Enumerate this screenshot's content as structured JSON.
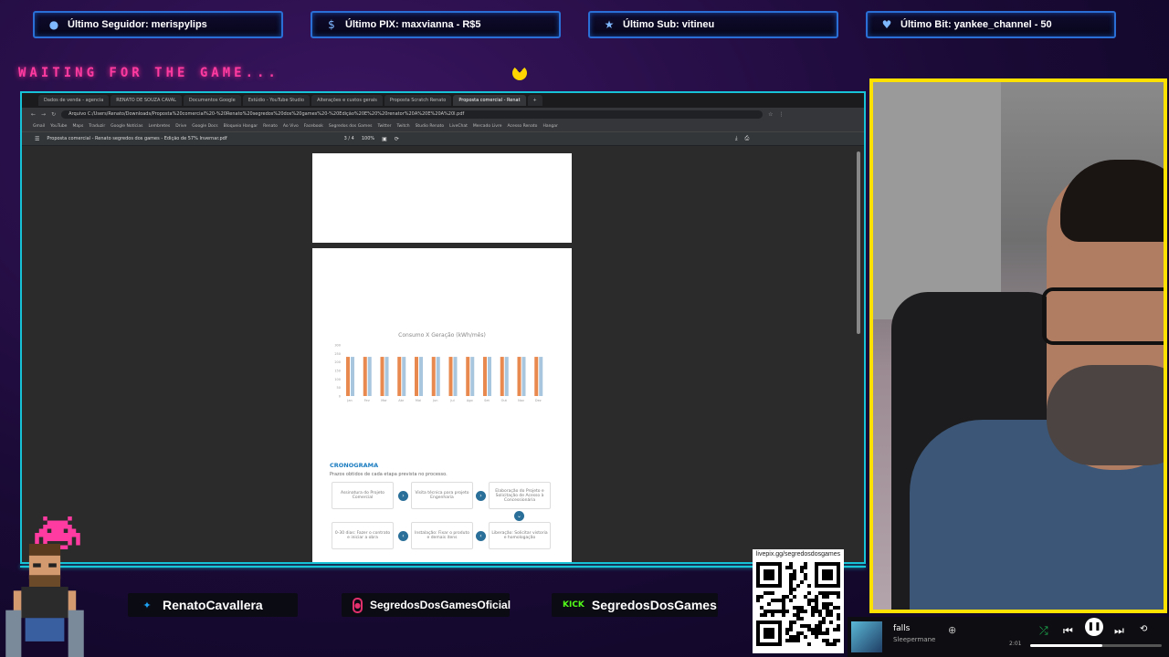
{
  "alerts": [
    {
      "label": "Último Seguidor: merispylips",
      "icon": "user-icon",
      "glyph": "●"
    },
    {
      "label": "Último PIX: maxvianna - R$5",
      "icon": "dollar-icon",
      "glyph": "$"
    },
    {
      "label": "Último Sub: vitineu",
      "icon": "star-icon",
      "glyph": "★"
    },
    {
      "label": "Último Bit: yankee_channel - 50",
      "icon": "heart-gem-icon",
      "glyph": "♥"
    }
  ],
  "waiting_text": "WAITING FOR THE GAME...",
  "browser": {
    "tabs": [
      "Dados de venda - agencia",
      "RENATO DE SOUZA CAVAL",
      "Documentos Google",
      "Estúdio - YouTube Studio",
      "Alterações e custos gerais",
      "Proposta Scratch Renato",
      "Proposta comercial - Renat"
    ],
    "active_tab": 6,
    "address": "Arquivo  C:/Users/Renato/Downloads/Proposta%20comercial%20-%20Renato%20segredos%20dos%20games%20-%20Edição%20E%20%20renator%20A%20E%20A%20l.pdf",
    "bookmarks": [
      "Gmail",
      "YouTube",
      "Maps",
      "Traduzir",
      "Google Notícias",
      "Lembretes",
      "Drive",
      "Google Docs",
      "Bloqueio Hangar",
      "Renato",
      "Ao Vivo",
      "Facebook",
      "Segredos dos Games",
      "Twitter",
      "Twitch",
      "Studio Renato",
      "LiveChat",
      "Mercado Livre",
      "Acesso Renato",
      "Hangar"
    ],
    "pdf_title": "Proposta comercial - Renato segredos dos games - Edição de 57% Invernar.pdf",
    "pdf_page": "3 / 4",
    "pdf_zoom": "100%"
  },
  "pdf": {
    "chart_title": "Consumo X Geração (kWh/mês)",
    "crono_title": "CRONOGRAMA",
    "crono_subtitle": "Prazos obtidos de cada etapa prevista no processo.",
    "steps": [
      "Assinatura do Projeto Comercial",
      "Visita técnica para projeto Engenharia",
      "Elaboração do Projeto e Solicitação de Acesso à Concessionária",
      "0-30 dias: Fazer o contrato e iniciar a obra",
      "Instalação: Fixar o produto e demais itens",
      "Liberação: Solicitar vistoria e homologação"
    ]
  },
  "chart_data": {
    "type": "bar",
    "categories": [
      "Jan",
      "Fev",
      "Mar",
      "Abr",
      "Mai",
      "Jun",
      "Jul",
      "Ago",
      "Set",
      "Out",
      "Nov",
      "Dez"
    ],
    "series": [
      {
        "name": "",
        "values": [
          230,
          230,
          230,
          230,
          230,
          230,
          230,
          230,
          230,
          230,
          230,
          230
        ],
        "color": "#e8894f"
      },
      {
        "name": "",
        "values": [
          230,
          230,
          230,
          230,
          230,
          230,
          230,
          230,
          230,
          230,
          230,
          230
        ],
        "color": "#a8c6de"
      }
    ],
    "ylim": [
      0,
      300
    ],
    "yticks": [
      0,
      50,
      100,
      150,
      200,
      250,
      300
    ]
  },
  "socials": [
    {
      "name": "RenatoCavallera",
      "icon": "twitter-icon",
      "glyph": "🐦",
      "color": "#1da1f2"
    },
    {
      "name": "SegredosDosGamesOficial",
      "icon": "instagram-icon",
      "glyph": "◎",
      "color": "#e1306c"
    },
    {
      "name": "SegredosDosGames",
      "icon": "kick-icon",
      "glyph": "KICK",
      "color": "#53fc18"
    }
  ],
  "qr": {
    "label": "livepix.gg/segredosdosgames"
  },
  "spotify": {
    "title": "falls",
    "artist": "Sleepermane",
    "time": "2:01",
    "progress": 0.55
  }
}
